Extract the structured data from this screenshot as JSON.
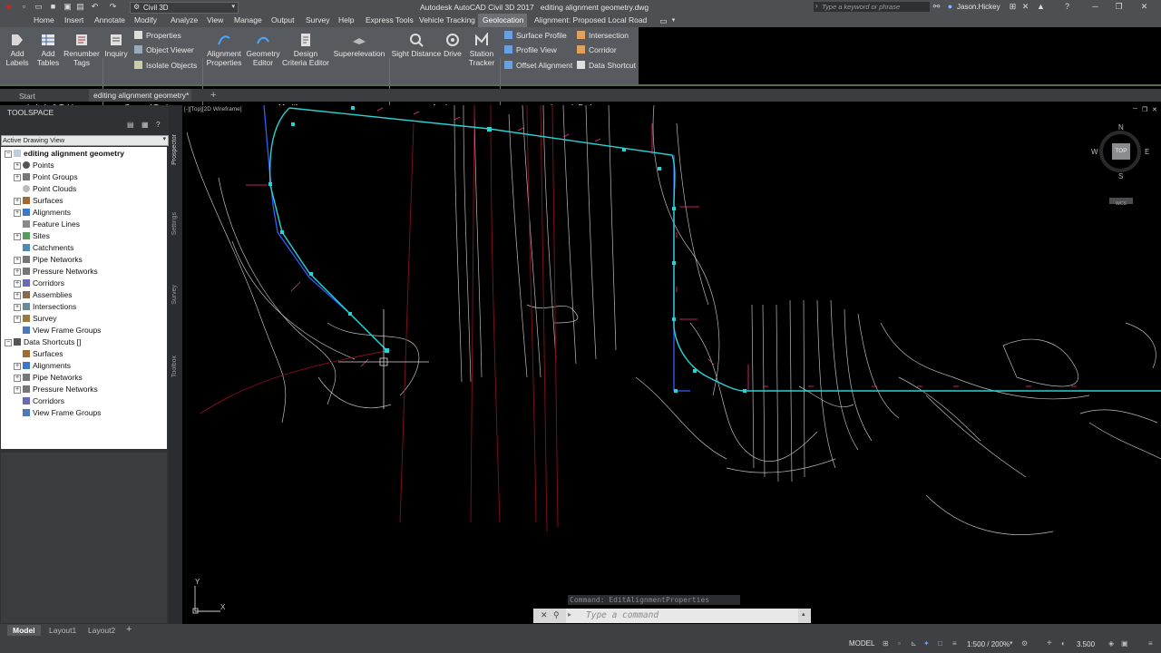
{
  "titlebar": {
    "workspace": "Civil 3D",
    "app_title": "Autodesk AutoCAD Civil 3D 2017",
    "file_name": "editing alignment geometry.dwg",
    "search_placeholder": "Type a keyword or phrase",
    "user": "Jason.Hickey"
  },
  "menu": {
    "items": [
      "Home",
      "Insert",
      "Annotate",
      "Modify",
      "Analyze",
      "View",
      "Manage",
      "Output",
      "Survey",
      "Help",
      "Express Tools",
      "Vehicle Tracking",
      "Geolocation",
      "Alignment: Proposed Local Road"
    ]
  },
  "ribbon": {
    "labels_tables": {
      "add_labels": "Add Labels",
      "add_tables": "Add Tables",
      "renumber_tags": "Renumber Tags",
      "panel": "Labels & Tables"
    },
    "general_tools": {
      "inquiry": "Inquiry",
      "properties": "Properties",
      "object_viewer": "Object Viewer",
      "isolate_objects": "Isolate Objects",
      "panel": "General Tools"
    },
    "modify": {
      "alignment_properties": "Alignment Properties",
      "geometry_editor": "Geometry Editor",
      "design_criteria_editor": "Design Criteria Editor",
      "superelevation": "Superelevation",
      "panel": "Modify"
    },
    "analyze": {
      "sight_distance": "Sight Distance",
      "drive": "Drive",
      "station_tracker": "Station Tracker",
      "panel": "Analyze"
    },
    "launch_pad": {
      "surface_profile": "Surface Profile",
      "profile_view": "Profile View",
      "offset_alignment": "Offset Alignment",
      "intersection": "Intersection",
      "corridor": "Corridor",
      "data_shortcut": "Data Shortcut",
      "panel": "Launch Pad"
    }
  },
  "doc_tabs": {
    "start": "Start",
    "active": "editing alignment geometry*"
  },
  "toolspace": {
    "title": "TOOLSPACE",
    "view_select": "Active Drawing View",
    "tree": {
      "root": "editing alignment geometry",
      "items": [
        "Points",
        "Point Groups",
        "Point Clouds",
        "Surfaces",
        "Alignments",
        "Feature Lines",
        "Sites",
        "Catchments",
        "Pipe Networks",
        "Pressure Networks",
        "Corridors",
        "Assemblies",
        "Intersections",
        "Survey",
        "View Frame Groups"
      ],
      "data_shortcuts": "Data Shortcuts []",
      "shortcut_items": [
        "Surfaces",
        "Alignments",
        "Pipe Networks",
        "Pressure Networks",
        "Corridors",
        "View Frame Groups"
      ]
    },
    "side_tabs": [
      "Prospector",
      "Settings",
      "Survey",
      "Toolbox"
    ]
  },
  "viewport": {
    "label": "[-][Top][2D Wireframe]",
    "compass": {
      "n": "N",
      "s": "S",
      "e": "E",
      "w": "W",
      "top": "TOP",
      "wcs": "WCS"
    },
    "ucs_x": "X",
    "ucs_y": "Y"
  },
  "command": {
    "history": "Command: EditAlignmentProperties",
    "placeholder": "Type a command"
  },
  "layouts": [
    "Model",
    "Layout1",
    "Layout2"
  ],
  "status": {
    "model": "MODEL",
    "scale": "1:500 / 200%",
    "value": "3.500"
  },
  "colors": {
    "ribbon": "#575a5e",
    "alignment": "#2ad3d3",
    "contours": "#c8c8c8",
    "red_lines": "#8a0f22"
  }
}
